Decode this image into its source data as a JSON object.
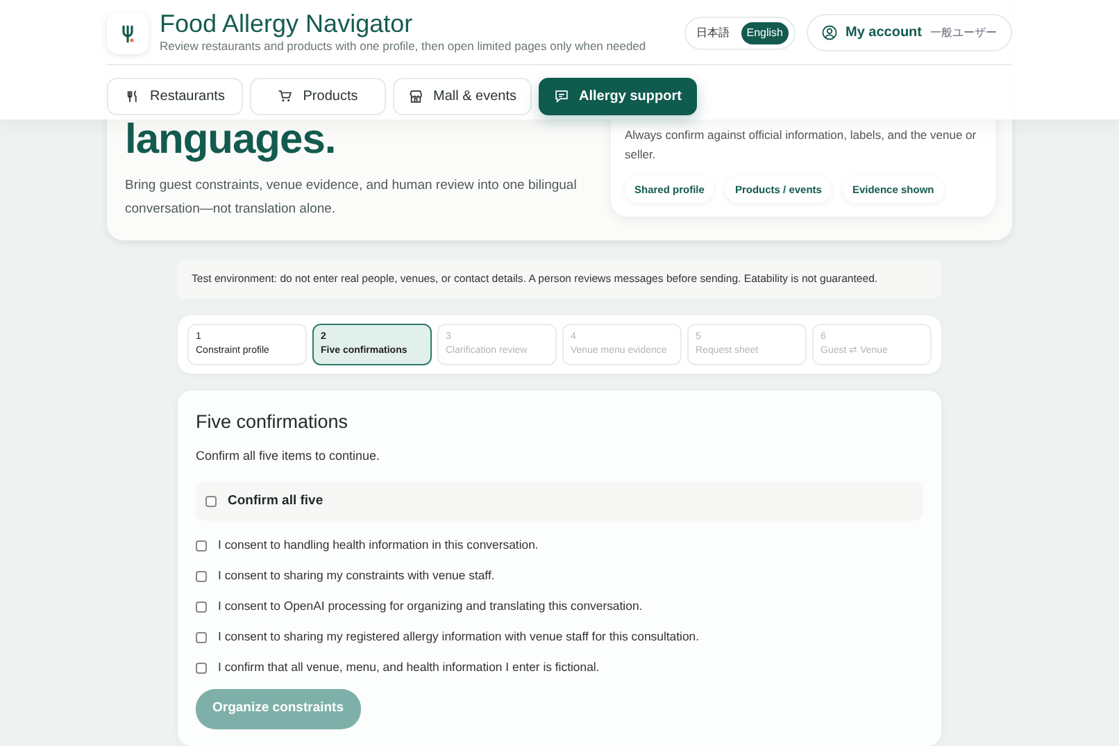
{
  "header": {
    "title": "Food Allergy Navigator",
    "subtitle": "Review restaurants and products with one profile, then open limited pages only when needed",
    "languages": [
      {
        "label": "日本語",
        "selected": false
      },
      {
        "label": "English",
        "selected": true
      }
    ],
    "account": {
      "label": "My account",
      "role": "一般ユーザー"
    }
  },
  "nav": [
    {
      "label": "Restaurants",
      "selected": false
    },
    {
      "label": "Products",
      "selected": false
    },
    {
      "label": "Mall & events",
      "selected": false
    },
    {
      "label": "Allergy support",
      "selected": true
    }
  ],
  "hero": {
    "heading": "languages.",
    "text": "Bring guest constraints, venue evidence, and human review into one bilingual conversation—not translation alone.",
    "panel": {
      "text": "Always confirm against official information, labels, and the venue or seller.",
      "tags": [
        "Shared profile",
        "Products / events",
        "Evidence shown"
      ]
    }
  },
  "notice": "Test environment: do not enter real people, venues, or contact details. A person reviews messages before sending. Eatability is not guaranteed.",
  "steps": [
    {
      "number": "1",
      "label": "Constraint profile",
      "selected": false,
      "disabled": false
    },
    {
      "number": "2",
      "label": "Five confirmations",
      "selected": true,
      "disabled": false
    },
    {
      "number": "3",
      "label": "Clarification review",
      "selected": false,
      "disabled": true
    },
    {
      "number": "4",
      "label": "Venue menu evidence",
      "selected": false,
      "disabled": true
    },
    {
      "number": "5",
      "label": "Request sheet",
      "selected": false,
      "disabled": true
    },
    {
      "number": "6",
      "label": "Guest ⇄ Venue",
      "selected": false,
      "disabled": true
    }
  ],
  "confirm": {
    "title": "Five confirmations",
    "hint": "Confirm all five items to continue.",
    "all": {
      "label": "Confirm all five",
      "checked": false
    },
    "items": [
      {
        "label": "I consent to handling health information in this conversation.",
        "checked": false
      },
      {
        "label": "I consent to sharing my constraints with venue staff.",
        "checked": false
      },
      {
        "label": "I consent to OpenAI processing for organizing and translating this conversation.",
        "checked": false
      },
      {
        "label": "I consent to sharing my registered allergy information with venue staff for this consultation.",
        "checked": false
      },
      {
        "label": "I confirm that all venue, menu, and health information I enter is fictional.",
        "checked": false
      }
    ],
    "button": {
      "label": "Organize constraints",
      "disabled": true
    }
  }
}
